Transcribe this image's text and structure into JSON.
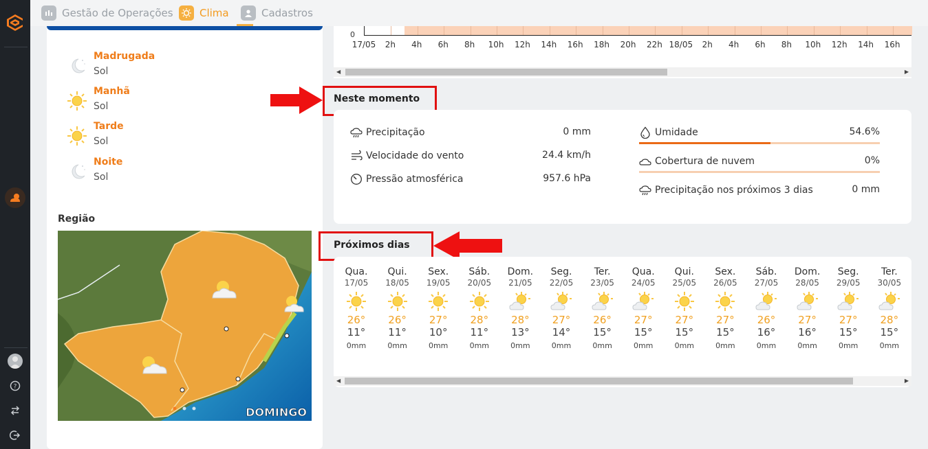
{
  "topbar": {
    "tabs": [
      {
        "label": "Gestão de Operações",
        "icon": "operations-icon"
      },
      {
        "label": "Clima",
        "icon": "sun-icon"
      },
      {
        "label": "Cadastros",
        "icon": "user-icon"
      }
    ]
  },
  "periods": [
    {
      "name": "Madrugada",
      "desc": "Sol",
      "icon": "moon-icon"
    },
    {
      "name": "Manhã",
      "desc": "Sol",
      "icon": "sun-icon"
    },
    {
      "name": "Tarde",
      "desc": "Sol",
      "icon": "sun-icon"
    },
    {
      "name": "Noite",
      "desc": "Sol",
      "icon": "moon-icon"
    }
  ],
  "regiao": {
    "title": "Região",
    "map_label": "DOMINGO"
  },
  "chart_data": {
    "type": "bar",
    "ylabel_zero": "0",
    "ticks": [
      "17/05",
      "2h",
      "4h",
      "6h",
      "8h",
      "10h",
      "12h",
      "14h",
      "16h",
      "18h",
      "20h",
      "22h",
      "18/05",
      "2h",
      "4h",
      "6h",
      "8h",
      "10h",
      "12h",
      "14h",
      "16h"
    ]
  },
  "now": {
    "title": "Neste momento",
    "left": [
      {
        "label": "Precipitação",
        "value": "0 mm",
        "icon": "rain-cloud-icon"
      },
      {
        "label": "Velocidade do vento",
        "value": "24.4 km/h",
        "icon": "wind-icon"
      },
      {
        "label": "Pressão atmosférica",
        "value": "957.6 hPa",
        "icon": "gauge-icon"
      }
    ],
    "right": [
      {
        "label": "Umidade",
        "value": "54.6%",
        "icon": "droplet-icon",
        "fraction": 0.546
      },
      {
        "label": "Cobertura de nuvem",
        "value": "0%",
        "icon": "cloud-icon",
        "fraction": 0
      },
      {
        "label": "Precipitação nos próximos 3 dias",
        "value": "0 mm",
        "icon": "rain-cloud-icon"
      }
    ]
  },
  "next": {
    "title": "Próximos dias",
    "days": [
      {
        "name": "Qua.",
        "date": "17/05",
        "max": "26°",
        "min": "11°",
        "prec": "0mm",
        "icon": "sun-icon"
      },
      {
        "name": "Qui.",
        "date": "18/05",
        "max": "26°",
        "min": "11°",
        "prec": "0mm",
        "icon": "sun-icon"
      },
      {
        "name": "Sex.",
        "date": "19/05",
        "max": "27°",
        "min": "10°",
        "prec": "0mm",
        "icon": "sun-icon"
      },
      {
        "name": "Sáb.",
        "date": "20/05",
        "max": "28°",
        "min": "11°",
        "prec": "0mm",
        "icon": "sun-icon"
      },
      {
        "name": "Dom.",
        "date": "21/05",
        "max": "28°",
        "min": "13°",
        "prec": "0mm",
        "icon": "sun-cloud-icon"
      },
      {
        "name": "Seg.",
        "date": "22/05",
        "max": "27°",
        "min": "14°",
        "prec": "0mm",
        "icon": "sun-cloud-icon"
      },
      {
        "name": "Ter.",
        "date": "23/05",
        "max": "26°",
        "min": "15°",
        "prec": "0mm",
        "icon": "sun-cloud-icon"
      },
      {
        "name": "Qua.",
        "date": "24/05",
        "max": "27°",
        "min": "15°",
        "prec": "0mm",
        "icon": "sun-cloud-icon"
      },
      {
        "name": "Qui.",
        "date": "25/05",
        "max": "27°",
        "min": "15°",
        "prec": "0mm",
        "icon": "sun-icon"
      },
      {
        "name": "Sex.",
        "date": "26/05",
        "max": "27°",
        "min": "15°",
        "prec": "0mm",
        "icon": "sun-icon"
      },
      {
        "name": "Sáb.",
        "date": "27/05",
        "max": "26°",
        "min": "16°",
        "prec": "0mm",
        "icon": "sun-cloud-icon"
      },
      {
        "name": "Dom.",
        "date": "28/05",
        "max": "27°",
        "min": "16°",
        "prec": "0mm",
        "icon": "sun-cloud-icon"
      },
      {
        "name": "Seg.",
        "date": "29/05",
        "max": "27°",
        "min": "15°",
        "prec": "0mm",
        "icon": "sun-cloud-icon"
      },
      {
        "name": "Ter.",
        "date": "30/05",
        "max": "28°",
        "min": "15°",
        "prec": "0mm",
        "icon": "sun-cloud-icon"
      }
    ]
  }
}
